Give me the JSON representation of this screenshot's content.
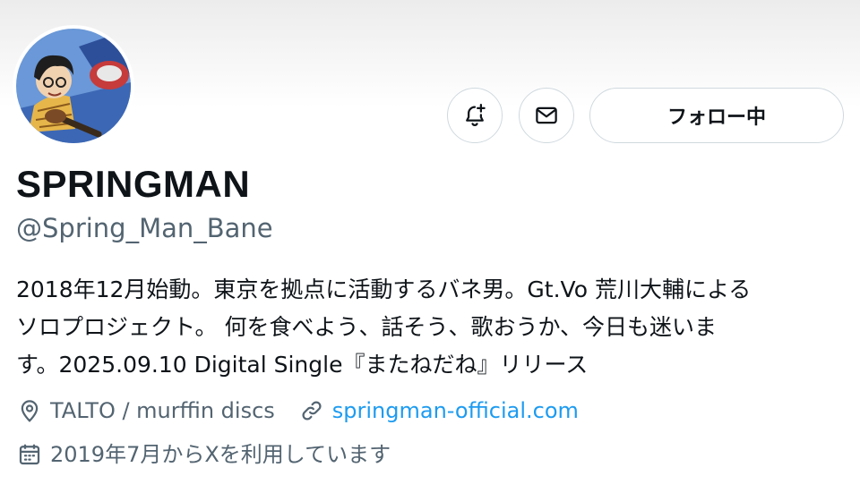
{
  "profile": {
    "display_name": "SPRINGMAN",
    "handle": "@Spring_Man_Bane",
    "bio_lines": [
      "2018年12月始動。東京を拠点に活動するバネ男。Gt.Vo 荒川大輔による",
      "ソロプロジェクト。 何を食べよう、話そう、歌おうか、今日も迷いま",
      "す。2025.09.10 Digital Single『またねだね』リリース"
    ],
    "location": "TALTO / murffin discs",
    "website": "springman-official.com",
    "joined": "2019年7月からXを利用しています"
  },
  "actions": {
    "follow_label": "フォロー中"
  },
  "icons": {
    "notify": "bell-plus-icon",
    "message": "envelope-icon",
    "location": "location-pin-icon",
    "link": "link-icon",
    "joined": "calendar-icon"
  },
  "colors": {
    "text": "#0f1419",
    "secondary": "#536471",
    "link": "#1d9bf0",
    "border": "#cfd9de"
  }
}
